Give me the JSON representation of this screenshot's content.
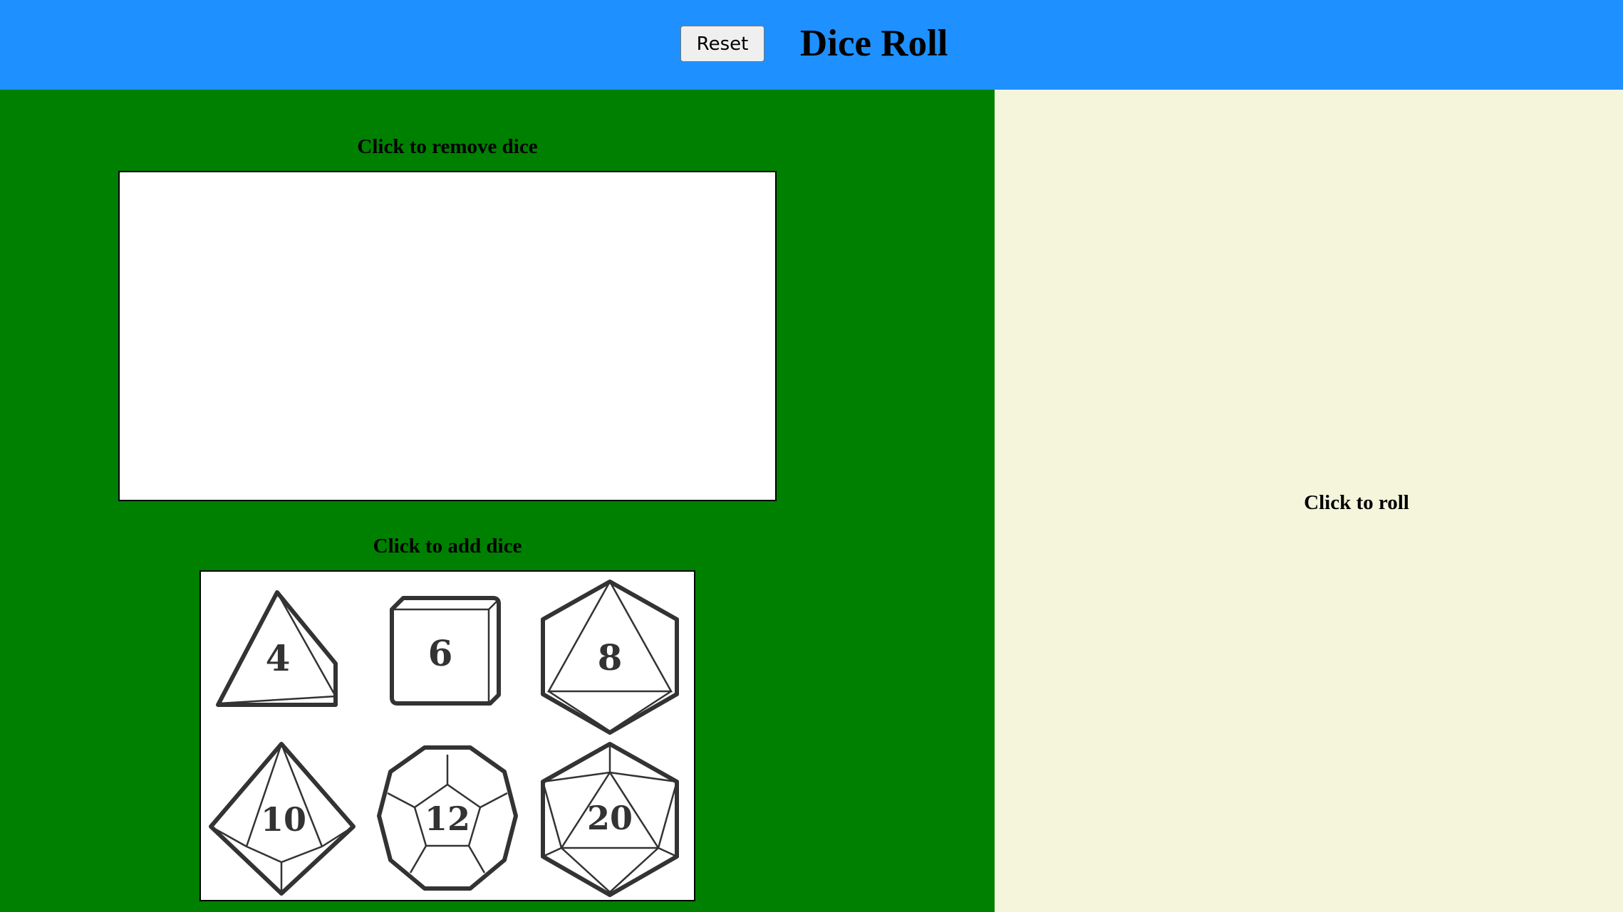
{
  "header": {
    "title": "Dice Roll",
    "reset_label": "Reset",
    "background": "#1e90ff"
  },
  "left_panel": {
    "background": "#008000",
    "remove_label": "Click to remove dice",
    "add_label": "Click to add dice",
    "dice": [
      {
        "sides": "4",
        "label": "4",
        "icon": "d4-icon"
      },
      {
        "sides": "6",
        "label": "6",
        "icon": "d6-icon"
      },
      {
        "sides": "8",
        "label": "8",
        "icon": "d8-icon"
      },
      {
        "sides": "10",
        "label": "10",
        "icon": "d10-icon"
      },
      {
        "sides": "12",
        "label": "12",
        "icon": "d12-icon"
      },
      {
        "sides": "20",
        "label": "20",
        "icon": "d20-icon"
      }
    ]
  },
  "right_panel": {
    "background": "#f5f5dc",
    "roll_label": "Click to roll"
  }
}
